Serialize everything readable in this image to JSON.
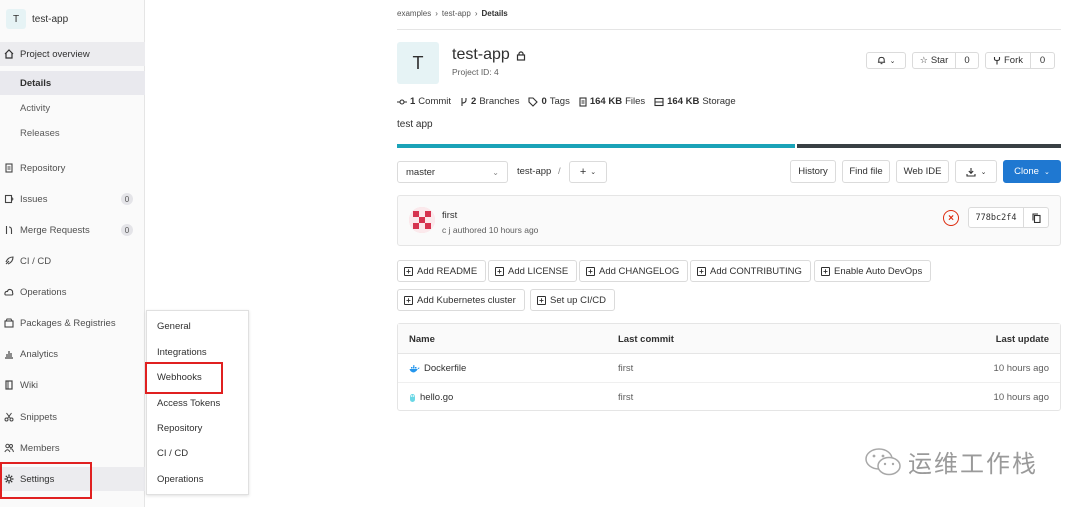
{
  "sidebar": {
    "avatar_letter": "T",
    "project_name": "test-app",
    "items": [
      {
        "label": "Project overview",
        "icon": "home-icon"
      },
      {
        "label": "Details"
      },
      {
        "label": "Activity"
      },
      {
        "label": "Releases"
      },
      {
        "label": "Repository",
        "icon": "doc-icon"
      },
      {
        "label": "Issues",
        "icon": "issues-icon",
        "badge": "0"
      },
      {
        "label": "Merge Requests",
        "icon": "merge-request-icon",
        "badge": "0"
      },
      {
        "label": "CI / CD",
        "icon": "rocket-icon"
      },
      {
        "label": "Operations",
        "icon": "cloud-icon"
      },
      {
        "label": "Packages & Registries",
        "icon": "package-icon"
      },
      {
        "label": "Analytics",
        "icon": "chart-icon"
      },
      {
        "label": "Wiki",
        "icon": "book-icon"
      },
      {
        "label": "Snippets",
        "icon": "scissors-icon"
      },
      {
        "label": "Members",
        "icon": "users-icon"
      },
      {
        "label": "Settings",
        "icon": "gear-icon"
      }
    ]
  },
  "settings_flyout": [
    "General",
    "Integrations",
    "Webhooks",
    "Access Tokens",
    "Repository",
    "CI / CD",
    "Operations"
  ],
  "breadcrumb": [
    "examples",
    "test-app",
    "Details"
  ],
  "project": {
    "avatar_letter": "T",
    "name": "test-app",
    "id_text": "Project ID: 4",
    "description": "test app"
  },
  "header_actions": {
    "star_label": "Star",
    "star_count": "0",
    "fork_label": "Fork",
    "fork_count": "0"
  },
  "stats": [
    {
      "value": "1",
      "label": "Commit"
    },
    {
      "value": "2",
      "label": "Branches"
    },
    {
      "value": "0",
      "label": "Tags"
    },
    {
      "value": "164 KB",
      "label": "Files"
    },
    {
      "value": "164 KB",
      "label": "Storage"
    }
  ],
  "language_bar": {
    "first_color": "#1aaa55",
    "first_fraction": 0.6,
    "second_color": "#394044"
  },
  "toolbar": {
    "branch": "master",
    "path": "test-app",
    "path_sep": "/",
    "plus": "+",
    "history": "History",
    "find_file": "Find file",
    "web_ide": "Web IDE",
    "clone": "Clone"
  },
  "last_commit": {
    "message": "first",
    "author_line": "c j authored 10 hours ago",
    "sha": "778bc2f4",
    "status_color": "#dd2b0e"
  },
  "quick_actions": [
    "Add README",
    "Add LICENSE",
    "Add CHANGELOG",
    "Add CONTRIBUTING",
    "Enable Auto DevOps",
    "Add Kubernetes cluster",
    "Set up CI/CD"
  ],
  "file_table": {
    "headers": [
      "Name",
      "Last commit",
      "Last update"
    ],
    "rows": [
      {
        "name": "Dockerfile",
        "icon": "docker-icon",
        "commit": "first",
        "updated": "10 hours ago"
      },
      {
        "name": "hello.go",
        "icon": "go-icon",
        "commit": "first",
        "updated": "10 hours ago"
      }
    ]
  },
  "watermark": "运维工作栈",
  "colors": {
    "accent": "#1f78d1",
    "red_highlight": "#e02020"
  }
}
